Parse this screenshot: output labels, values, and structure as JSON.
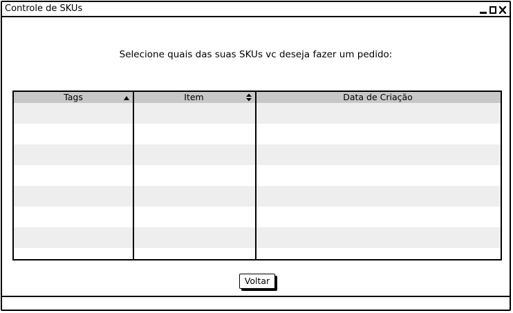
{
  "window": {
    "title": "Controle de SKUs"
  },
  "instruction": "Selecione quais das suas SKUs vc deseja fazer um pedido:",
  "table": {
    "columns": [
      {
        "label": "Tags",
        "sort": "ascending",
        "sort_icon": "triangle-up-icon"
      },
      {
        "label": "Item",
        "sort": "both",
        "sort_icon": "sort-updown-icon"
      },
      {
        "label": "Data de Criação",
        "sort": "none"
      }
    ],
    "rows": [
      [
        "",
        "",
        ""
      ],
      [
        "",
        "",
        ""
      ],
      [
        "",
        "",
        ""
      ],
      [
        "",
        "",
        ""
      ],
      [
        "",
        "",
        ""
      ],
      [
        "",
        "",
        ""
      ],
      [
        "",
        "",
        ""
      ],
      [
        "",
        "",
        ""
      ]
    ],
    "header_color": "#c7c7c7",
    "stripe_color": "#eeeeee"
  },
  "buttons": {
    "back_label": "Voltar"
  }
}
